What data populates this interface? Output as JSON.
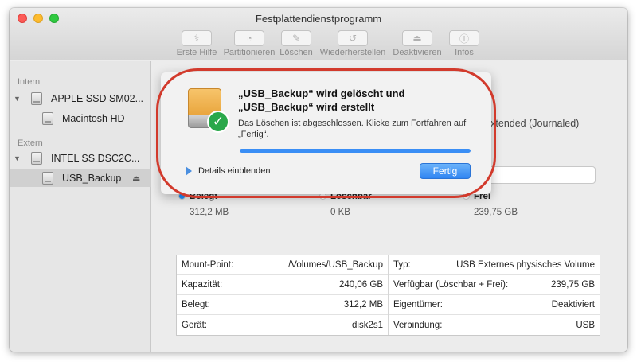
{
  "window": {
    "title": "Festplattendienstprogramm"
  },
  "toolbar": {
    "items": [
      {
        "label": "Erste Hilfe",
        "icon": "first-aid-icon",
        "glyph": "⚕"
      },
      {
        "label": "Partitionieren",
        "icon": "partition-icon",
        "glyph": "◔"
      },
      {
        "label": "Löschen",
        "icon": "erase-icon",
        "glyph": "✎"
      },
      {
        "label": "Wiederherstellen",
        "icon": "restore-icon",
        "glyph": "↺"
      },
      {
        "label": "Deaktivieren",
        "icon": "unmount-icon",
        "glyph": "⏏"
      },
      {
        "label": "Infos",
        "icon": "info-icon",
        "glyph": "ⓘ"
      }
    ]
  },
  "sidebar": {
    "intern_label": "Intern",
    "extern_label": "Extern",
    "intern_disk": "APPLE SSD SM02...",
    "intern_volume": "Macintosh HD",
    "extern_disk": "INTEL SS DSC2C...",
    "extern_volume": "USB_Backup",
    "eject_glyph": "⏏"
  },
  "main": {
    "format": "S Extended (Journaled)",
    "legend": [
      {
        "name": "Belegt",
        "value": "312,2 MB",
        "color": "#1e90ff"
      },
      {
        "name": "Löschbar",
        "value": "0 KB",
        "color": "#ffffff"
      },
      {
        "name": "Frei",
        "value": "239,75 GB",
        "color": "#ffffff"
      }
    ],
    "info_left": [
      {
        "label": "Mount-Point:",
        "value": "/Volumes/USB_Backup"
      },
      {
        "label": "Kapazität:",
        "value": "240,06 GB"
      },
      {
        "label": "Belegt:",
        "value": "312,2 MB"
      },
      {
        "label": "Gerät:",
        "value": "disk2s1"
      }
    ],
    "info_right": [
      {
        "label": "Typ:",
        "value": "USB Externes physisches Volume"
      },
      {
        "label": "Verfügbar (Löschbar + Frei):",
        "value": "239,75 GB"
      },
      {
        "label": "Eigentümer:",
        "value": "Deaktiviert"
      },
      {
        "label": "Verbindung:",
        "value": "USB"
      }
    ]
  },
  "dialog": {
    "title_line1": "„USB_Backup“ wird gelöscht und",
    "title_line2": "„USB_Backup“ wird erstellt",
    "message_line1": "Das Löschen ist abgeschlossen. Klicke zum Fortfahren auf",
    "message_line2": "„Fertig“.",
    "progress_percent": 100,
    "details_label": "Details einblenden",
    "done_button": "Fertig",
    "check_glyph": "✓",
    "highlight_color": "#d23a2c"
  }
}
